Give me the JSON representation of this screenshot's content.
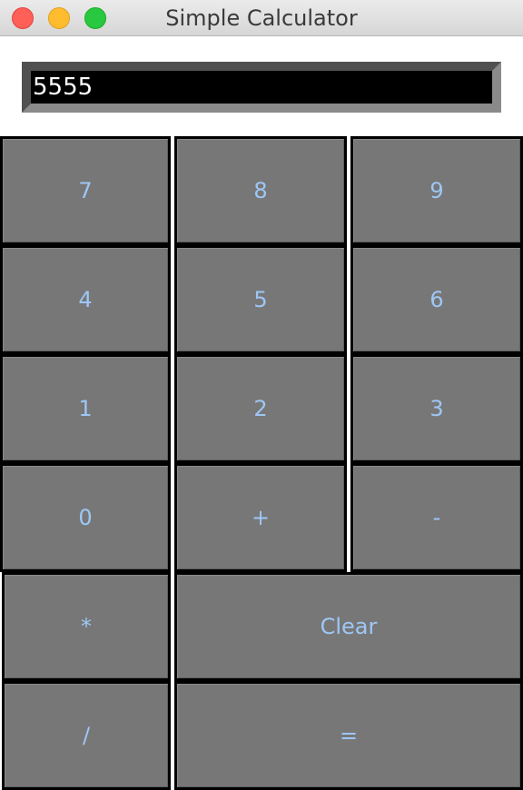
{
  "window": {
    "title": "Simple Calculator"
  },
  "display": {
    "value": "5555"
  },
  "buttons": {
    "seven": "7",
    "eight": "8",
    "nine": "9",
    "four": "4",
    "five": "5",
    "six": "6",
    "one": "1",
    "two": "2",
    "three": "3",
    "zero": "0",
    "plus": "+",
    "minus": "-",
    "multiply": "*",
    "clear": "Clear",
    "divide": "/",
    "equals": "="
  },
  "colors": {
    "button_face": "#777777",
    "button_text": "#9ec7f5",
    "display_bg": "#000000",
    "display_text": "#ffffff"
  }
}
